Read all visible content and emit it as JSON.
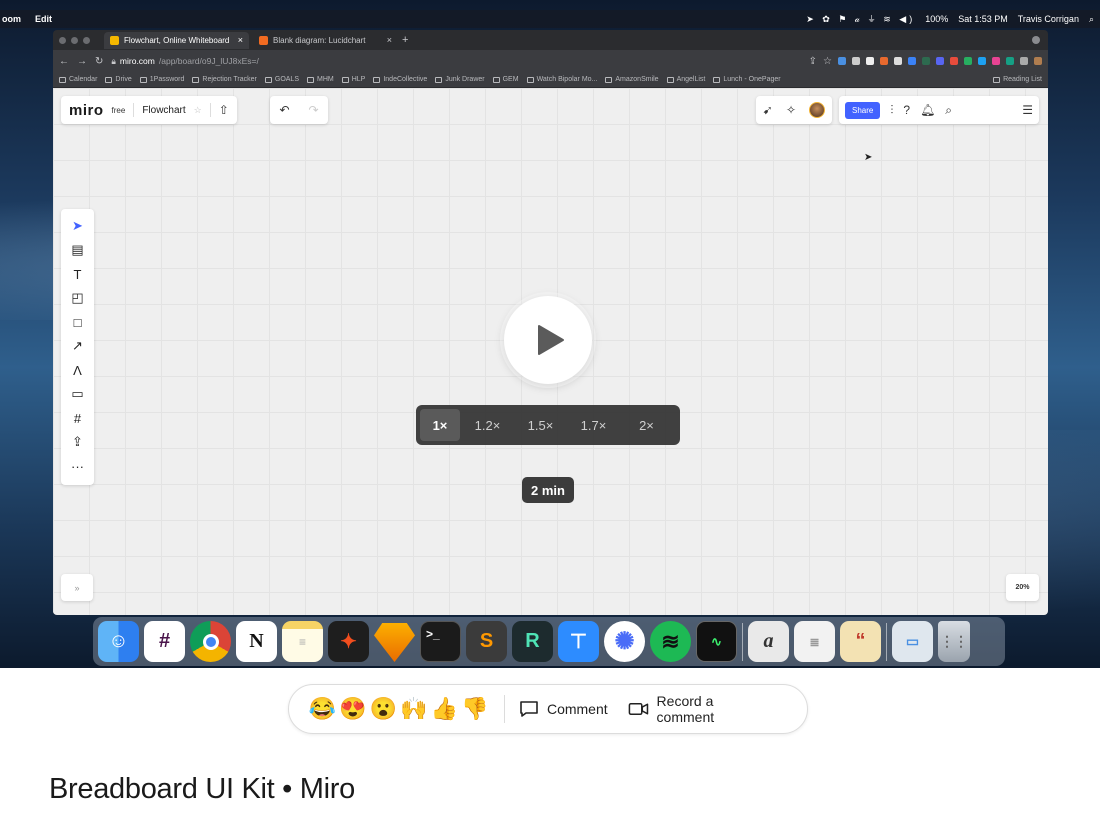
{
  "menubar": {
    "app": "oom",
    "menu": "Edit",
    "status_glyphs": "➤ ✿ ⚑ 𝒶 ⏚ ≋ ◀)",
    "battery": "100%",
    "clock": "Sat 1:53 PM",
    "user": "Travis Corrigan"
  },
  "browser": {
    "tabs": [
      {
        "label": "Flowchart, Online Whiteboard",
        "color": "#f5b800"
      },
      {
        "label": "Blank diagram: Lucidchart",
        "color": "#f26b21"
      }
    ],
    "url_host": "miro.com",
    "url_path": "/app/board/o9J_lUJ8xEs=/",
    "bookmarks": [
      "Calendar",
      "Drive",
      "1Password",
      "Rejection Tracker",
      "GOALS",
      "MHM",
      "HLP",
      "IndeCollective",
      "Junk Drawer",
      "GEM",
      "Watch Bipolar Mo...",
      "AmazonSmile",
      "AngelList",
      "Lunch - OnePager"
    ],
    "reading_list": "Reading List"
  },
  "miro": {
    "logo": "miro",
    "plan": "free",
    "board_name": "Flowchart",
    "share_label": "Share",
    "zoom": "20%",
    "expand": "»",
    "tools": [
      "select-tool",
      "template-tool",
      "text-tool",
      "sticky-note-tool",
      "shape-tool",
      "connector-tool",
      "pen-tool",
      "comment-tool",
      "frame-tool",
      "upload-tool",
      "more-tools"
    ]
  },
  "player": {
    "speeds": [
      "1×",
      "1.2×",
      "1.5×",
      "1.7×",
      "2×"
    ],
    "selected_speed": "1×",
    "duration": "2 min"
  },
  "reactions": {
    "emojis": [
      "😂",
      "😍",
      "😮",
      "🙌",
      "👍",
      "👎"
    ],
    "comment_label": "Comment",
    "record_label": "Record a comment"
  },
  "video_title": "Breadboard UI Kit • Miro",
  "colors": {
    "miro_accent": "#4262ff",
    "canvas_bg": "#efefef"
  }
}
